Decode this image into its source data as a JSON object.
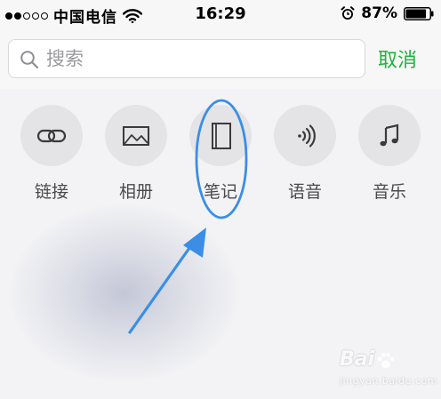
{
  "status_bar": {
    "signal_bars": 5,
    "signal_filled": 2,
    "carrier": "中国电信",
    "time": "16:29",
    "battery_percent": "87%",
    "battery_level": 0.87
  },
  "search": {
    "placeholder": "搜索",
    "cancel_label": "取消"
  },
  "options": [
    {
      "label": "链接",
      "icon": "link-icon"
    },
    {
      "label": "相册",
      "icon": "photo-icon"
    },
    {
      "label": "笔记",
      "icon": "notebook-icon"
    },
    {
      "label": "语音",
      "icon": "voice-icon"
    },
    {
      "label": "音乐",
      "icon": "music-icon"
    }
  ],
  "annotation": {
    "highlight_color": "#3a8ee6",
    "highlighted_option": "笔记"
  },
  "watermark": {
    "logo": "Bai",
    "subtitle": "jingyan.baidu.com"
  },
  "colors": {
    "accent_green": "#1fb33b",
    "icon_dark": "#3a3a3c",
    "circle_bg": "#e4e4e7"
  }
}
